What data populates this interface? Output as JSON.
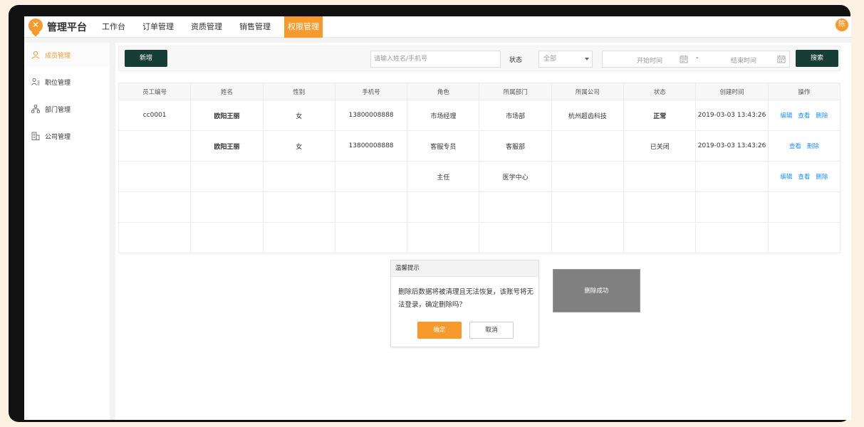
{
  "app": {
    "logo_glyph": "✕",
    "brand": "管理平台",
    "avatar": "陈",
    "accent_color": "#f79a2e",
    "dark_button_color": "#173e34"
  },
  "nav": {
    "items": [
      "工作台",
      "订单管理",
      "资质管理",
      "销售管理",
      "权限管理"
    ],
    "active": "权限管理"
  },
  "sidebar": {
    "items": [
      {
        "label": "成员管理",
        "icon": "user-icon",
        "active": true
      },
      {
        "label": "职位管理",
        "icon": "position-icon",
        "active": false
      },
      {
        "label": "部门管理",
        "icon": "org-chart-icon",
        "active": false
      },
      {
        "label": "公司管理",
        "icon": "building-icon",
        "active": false
      }
    ]
  },
  "toolbar": {
    "add_label": "新增",
    "search_placeholder": "请输入姓名/手机号",
    "status_label": "状态",
    "status_value": "全部",
    "start_placeholder": "开始时间",
    "range_separator": "-",
    "end_placeholder": "结束时间",
    "search_label": "搜索"
  },
  "table": {
    "headers": [
      "员工编号",
      "姓名",
      "性别",
      "手机号",
      "角色",
      "所属部门",
      "所属公司",
      "状态",
      "创建时间",
      "操作"
    ],
    "rows": [
      {
        "id": "cc0001",
        "name": "欧阳王丽",
        "gender": "女",
        "phone": "13800008888",
        "role": "市场经理",
        "dept": "市场部",
        "company": "杭州超齿科技",
        "status": "正常",
        "created": "2019-03-03 13:43:26",
        "ops": [
          "编辑",
          "查看",
          "删除"
        ]
      },
      {
        "id": "",
        "name": "欧阳王丽",
        "gender": "女",
        "phone": "13800008888",
        "role": "客服专员",
        "dept": "客服部",
        "company": "",
        "status": "已关闭",
        "created": "2019-03-03 13:43:26",
        "ops": [
          "查看",
          "删除"
        ]
      },
      {
        "id": "",
        "name": "",
        "gender": "",
        "phone": "",
        "role": "主任",
        "dept": "医学中心",
        "company": "",
        "status": "",
        "created": "",
        "ops": [
          "编辑",
          "查看",
          "删除"
        ]
      },
      {
        "id": "",
        "name": "",
        "gender": "",
        "phone": "",
        "role": "",
        "dept": "",
        "company": "",
        "status": "",
        "created": "",
        "ops": []
      },
      {
        "id": "",
        "name": "",
        "gender": "",
        "phone": "",
        "role": "",
        "dept": "",
        "company": "",
        "status": "",
        "created": "",
        "ops": []
      }
    ]
  },
  "dialog": {
    "title": "温馨提示",
    "message": "删除后数据将被清理且无法恢复，该账号将无法登录，确定删除吗？",
    "ok_label": "确定",
    "cancel_label": "取消"
  },
  "toast": {
    "message": "删除成功"
  }
}
